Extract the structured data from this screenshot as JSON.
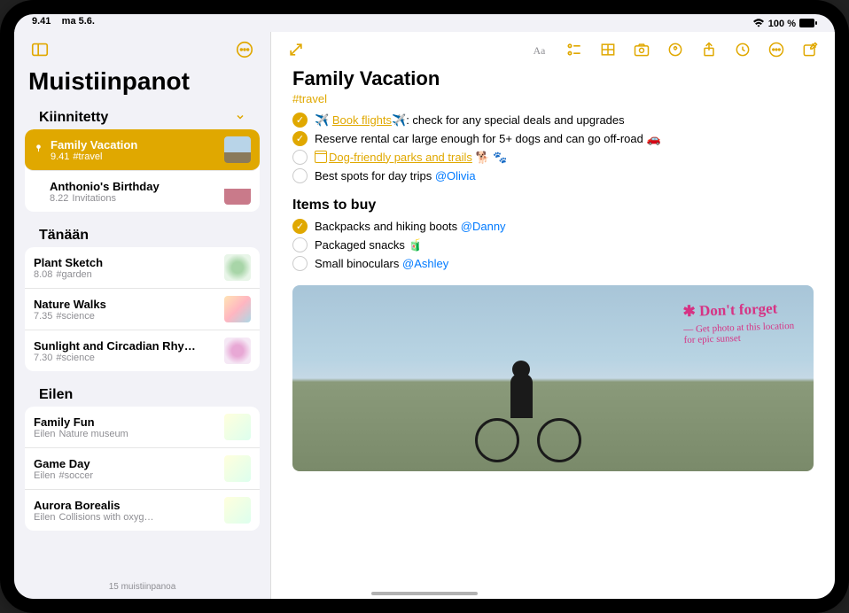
{
  "status": {
    "time": "9.41",
    "date": "ma 5.6.",
    "wifi": "wifi",
    "battery": "100 %"
  },
  "sidebar": {
    "title": "Muistiinpanot",
    "sections": [
      {
        "header": "Kiinnitetty",
        "collapsed": false,
        "items": [
          {
            "title": "Family Vacation",
            "time": "9.41",
            "tag": "#travel",
            "pinned": true,
            "selected": true
          },
          {
            "title": "Anthonio's Birthday",
            "time": "8.22",
            "tag": "Invitations",
            "pinned": false,
            "selected": false
          }
        ]
      },
      {
        "header": "Tänään",
        "items": [
          {
            "title": "Plant Sketch",
            "time": "8.08",
            "tag": "#garden"
          },
          {
            "title": "Nature Walks",
            "time": "7.35",
            "tag": "#science"
          },
          {
            "title": "Sunlight and Circadian Rhy…",
            "time": "7.30",
            "tag": "#science"
          }
        ]
      },
      {
        "header": "Eilen",
        "items": [
          {
            "title": "Family Fun",
            "time": "Eilen",
            "tag": "Nature museum"
          },
          {
            "title": "Game Day",
            "time": "Eilen",
            "tag": "#soccer"
          },
          {
            "title": "Aurora Borealis",
            "time": "Eilen",
            "tag": "Collisions with oxyg…"
          }
        ]
      }
    ],
    "footer": "15 muistiinpanoa"
  },
  "note": {
    "title": "Family Vacation",
    "tag": "#travel",
    "checklist1": [
      {
        "checked": true,
        "prefix_emoji": "✈️ ",
        "link": "Book flights",
        "after_emoji": "✈️",
        "rest": ": check for any special deals and upgrades"
      },
      {
        "checked": true,
        "text": "Reserve rental car large enough for 5+ dogs and can go off-road 🚗"
      },
      {
        "checked": false,
        "calendar": true,
        "link": "Dog-friendly parks and trails",
        "rest_emoji": " 🐕 🐾"
      },
      {
        "checked": false,
        "text": "Best spots for day trips ",
        "mention": "@Olivia"
      }
    ],
    "subheading": "Items to buy",
    "checklist2": [
      {
        "checked": true,
        "text": "Backpacks and hiking boots ",
        "mention": "@Danny"
      },
      {
        "checked": false,
        "text": "Packaged snacks 🧃"
      },
      {
        "checked": false,
        "text": "Small binoculars ",
        "mention": "@Ashley"
      }
    ],
    "handwriting": {
      "star": "✱",
      "line1": "Don't forget",
      "line2": "— Get photo at this location",
      "line3": "for epic sunset"
    }
  }
}
